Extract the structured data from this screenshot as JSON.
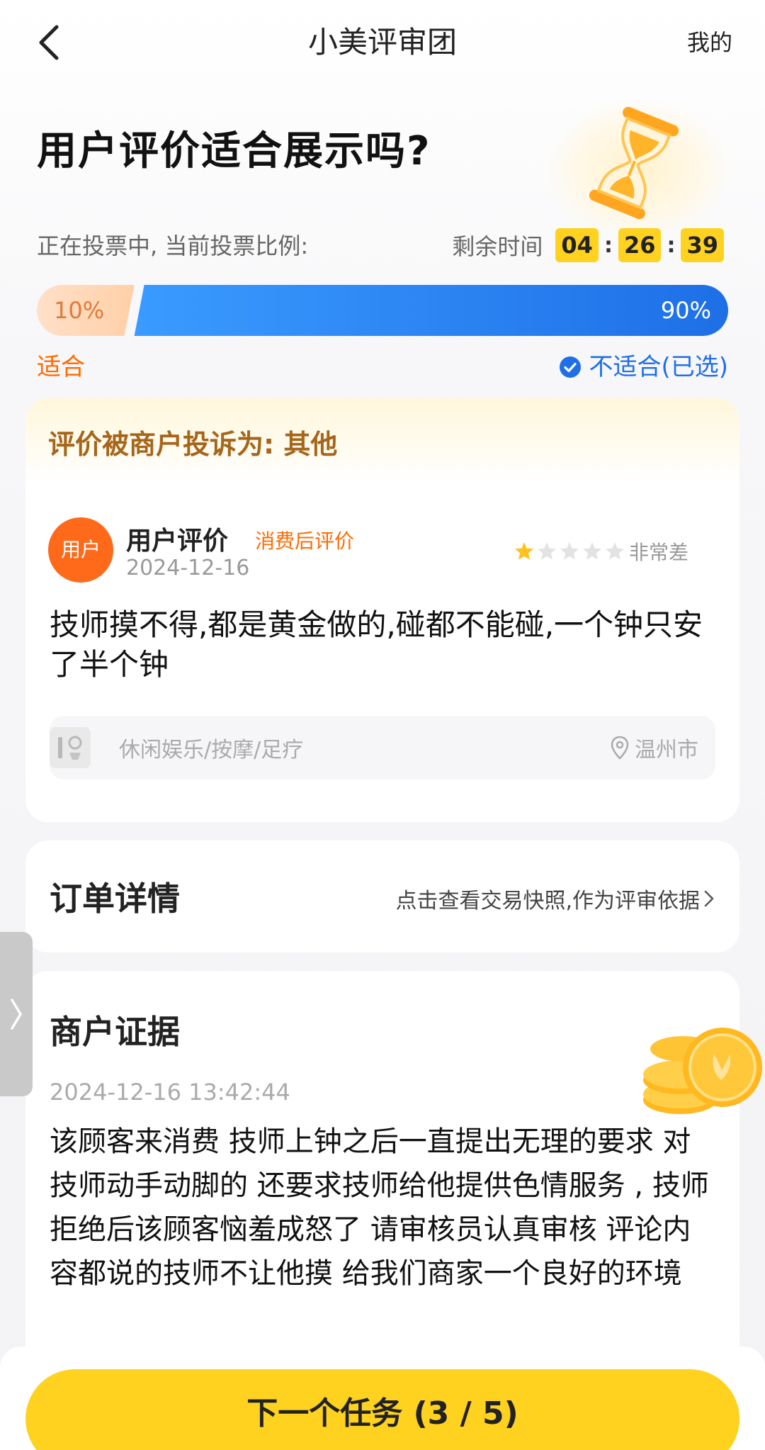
{
  "nav": {
    "title": "小美评审团",
    "right_link": "我的"
  },
  "question": "用户评价适合展示吗?",
  "vote": {
    "status_text": "正在投票中, 当前投票比例:",
    "remaining_label": "剩余时间",
    "time": {
      "hours": "04",
      "minutes": "26",
      "seconds": "39"
    },
    "suitable_percent_text": "10%",
    "unsuitable_percent_text": "90%",
    "suitable_fraction": 0.1,
    "option_suitable": "适合",
    "option_unsuitable": "不适合(已选)",
    "colors": {
      "suitable": "#ff6a00",
      "unsuitable": "#1f6fe8"
    }
  },
  "review": {
    "complaint": "评价被商户投诉为: 其他",
    "avatar_text": "用户",
    "reviewer": "用户评价",
    "tag": "消费后评价",
    "date": "2024-12-16",
    "rating": 1,
    "rating_max": 5,
    "rating_text": "非常差",
    "body": "技师摸不得,都是黄金做的,碰都不能碰,一个钟只安了半个钟",
    "category": "休闲娱乐/按摩/足疗",
    "location": "温州市"
  },
  "order": {
    "title": "订单详情",
    "link": "点击查看交易快照,作为评审依据"
  },
  "evidence": {
    "title": "商户证据",
    "datetime": "2024-12-16 13:42:44",
    "body": "该顾客来消费 技师上钟之后一直提出无理的要求 对技师动手动脚的 还要求技师给他提供色情服务 , 技师拒绝后该顾客恼羞成怒了 请审核员认真审核 评论内容都说的技师不让他摸 给我们商家一个良好的环境"
  },
  "footer": {
    "next_button": "下一个任务 (3 / 5)"
  },
  "icons": [
    "chevron-left-icon",
    "hourglass-icon",
    "check-circle-icon",
    "star-icon",
    "category-icon",
    "location-pin-icon",
    "chevron-right-icon",
    "coins-icon"
  ]
}
